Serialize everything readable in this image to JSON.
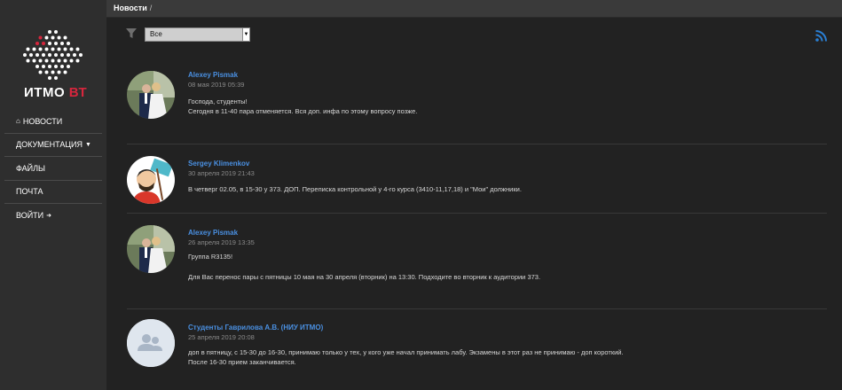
{
  "sidebar": {
    "logo_text_main": "ИТМО",
    "logo_text_accent": "ВТ",
    "nav": [
      {
        "label": "НОВОСТИ",
        "icon": "home-icon"
      },
      {
        "label": "ДОКУМЕНТАЦИЯ",
        "icon": "caret-down-icon"
      },
      {
        "label": "ФАЙЛЫ"
      },
      {
        "label": "ПОЧТА"
      },
      {
        "label": "ВОЙТИ",
        "icon": "sign-in-icon"
      }
    ]
  },
  "header": {
    "breadcrumb": "Новости",
    "separator": "/"
  },
  "filter": {
    "selected": "Все",
    "icon": "filter-icon"
  },
  "rss": {
    "icon": "rss-icon"
  },
  "colors": {
    "accent": "#4a90e2",
    "brand_red": "#d7263d",
    "rss": "#2a7fd4"
  },
  "posts": [
    {
      "author": "Alexey Pismak",
      "date": "08 мая 2019 05:39",
      "lines": [
        "Господа, студенты!",
        "Сегодня в 11-40 пара отменяется. Вся доп. инфа по этому вопросу позже."
      ]
    },
    {
      "author": "Sergey Klimenkov",
      "date": "30 апреля 2019 21:43",
      "lines": [
        "В четверг 02.05, в 15-30 у 373. ДОП. Переписка контрольной у 4-го курса (3410-11,17,18) и \"Мои\" должники."
      ]
    },
    {
      "author": "Alexey Pismak",
      "date": "26 апреля 2019 13:35",
      "lines": [
        "Группа R3135!",
        "Для Вас перенос пары с пятницы 10 мая на 30 апреля (вторник) на 13:30. Подходите во вторник к аудитории 373."
      ]
    },
    {
      "author": "Студенты Гаврилова А.В. (НИУ ИТМО)",
      "date": "25 апреля 2019 20:08",
      "lines": [
        "доп в пятницу, с 15-30 до 16-30, принимаю только у тех, у кого уже начал принимать лабу. Экзамены в этот раз не принимаю - доп короткий.",
        "После 16-30 прием заканчивается."
      ]
    }
  ]
}
